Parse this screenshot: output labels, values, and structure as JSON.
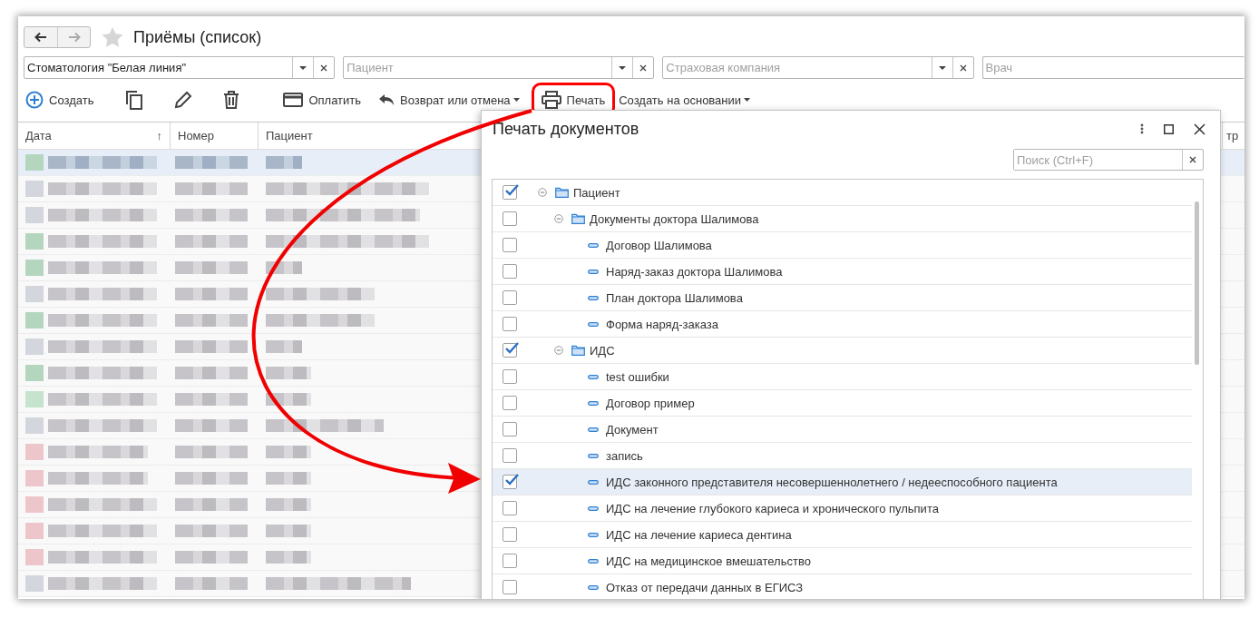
{
  "window": {
    "title": "Приёмы (список)",
    "favorite": false
  },
  "filters": [
    {
      "value": "Стоматология \"Белая линия\""
    },
    {
      "placeholder": "Пациент"
    },
    {
      "placeholder": "Страховая компания"
    },
    {
      "placeholder": "Врач"
    }
  ],
  "toolbar": [
    {
      "kind": "create",
      "label": "Создать"
    },
    {
      "kind": "copy"
    },
    {
      "kind": "edit"
    },
    {
      "kind": "delete"
    },
    {
      "kind": "pay",
      "label": "Оплатить"
    },
    {
      "kind": "return",
      "label": "Возврат или отмена",
      "dropdown": true
    },
    {
      "kind": "print",
      "label": "Печать",
      "highlighted": true
    },
    {
      "kind": "based",
      "label": "Создать на основании",
      "dropdown": true
    }
  ],
  "table": {
    "columns": [
      {
        "label": "Дата",
        "sort": "↑"
      },
      {
        "label": "Номер"
      },
      {
        "label": "Пациент"
      },
      {
        "label": "тр"
      }
    ],
    "rows": [
      {
        "selected": true,
        "color": "#b4d6bf"
      },
      {
        "selected": false,
        "color": "#d3d6dc"
      },
      {
        "selected": false,
        "color": "#d3d6dc"
      },
      {
        "selected": false,
        "color": "#b4d6bf"
      },
      {
        "selected": false,
        "color": "#b4d6bf"
      },
      {
        "selected": false,
        "color": "#d3d6dc"
      },
      {
        "selected": false,
        "color": "#b4d6bf"
      },
      {
        "selected": false,
        "color": "#d3d6dc"
      },
      {
        "selected": false,
        "color": "#b4d6bf"
      },
      {
        "selected": false,
        "color": "#c6e3cd"
      },
      {
        "selected": false,
        "color": "#d3d6dc"
      },
      {
        "selected": false,
        "color": "#ecc6cb"
      },
      {
        "selected": false,
        "color": "#ecc6cb"
      },
      {
        "selected": false,
        "color": "#ecc6cb"
      },
      {
        "selected": false,
        "color": "#ecc6cb"
      },
      {
        "selected": false,
        "color": "#ecc6cb"
      },
      {
        "selected": false,
        "color": "#d3d6dc"
      }
    ]
  },
  "dialog": {
    "title": "Печать документов",
    "search": {
      "placeholder": "Поиск (Ctrl+F)"
    },
    "tree": [
      {
        "label": "Пациент",
        "checked": true,
        "selected": false,
        "expanded": true,
        "children": [
          {
            "label": "Документы доктора Шалимова",
            "checked": false,
            "selected": false,
            "expanded": true,
            "children": [
              {
                "label": "Договор Шалимова",
                "checked": false,
                "selected": false
              },
              {
                "label": "Наряд-заказ доктора Шалимова",
                "checked": false,
                "selected": false
              },
              {
                "label": "План доктора Шалимова",
                "checked": false,
                "selected": false
              },
              {
                "label": "Форма наряд-заказа",
                "checked": false,
                "selected": false
              }
            ]
          },
          {
            "label": "ИДС",
            "checked": true,
            "selected": false,
            "expanded": true,
            "children": [
              {
                "label": "test ошибки",
                "checked": false,
                "selected": false
              },
              {
                "label": "Договор пример",
                "checked": false,
                "selected": false
              },
              {
                "label": "Документ",
                "checked": false,
                "selected": false
              },
              {
                "label": "запись",
                "checked": false,
                "selected": false
              },
              {
                "label": "ИДС законного представителя несовершеннолетнего / недееспособного пациента",
                "checked": true,
                "selected": true
              },
              {
                "label": "ИДС на лечение глубокого кариеса и хронического пульпита",
                "checked": false,
                "selected": false
              },
              {
                "label": "ИДС на лечение кариеса дентина",
                "checked": false,
                "selected": false
              },
              {
                "label": "ИДС на медицинское вмешательство",
                "checked": false,
                "selected": false
              },
              {
                "label": "Отказ от передачи данных в ЕГИСЗ",
                "checked": false,
                "selected": false
              }
            ]
          }
        ]
      }
    ]
  },
  "annotation": {
    "arrow": true
  }
}
